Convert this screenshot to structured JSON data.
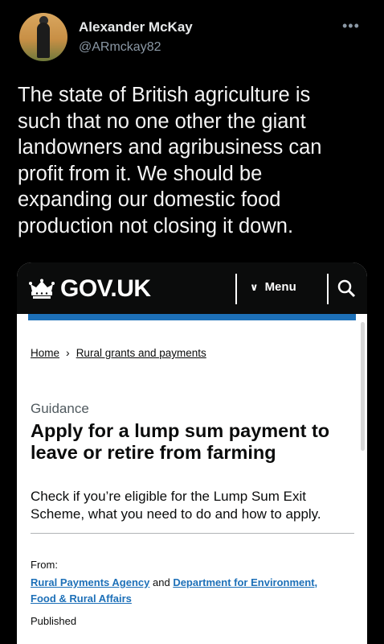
{
  "tweet": {
    "author_name": "Alexander McKay",
    "author_handle": "@ARmckay82",
    "more_icon": "more-horizontal-icon",
    "text_lines": [
      "The state of British agriculture is",
      "such that no one other the giant",
      "landowners and agribusiness can",
      "profit from it. We should be",
      "expanding our domestic food",
      "production not closing it down."
    ]
  },
  "govuk": {
    "logo_text": "GOV.UK",
    "menu_label": "Menu",
    "colors": {
      "header": "#0b0c0c",
      "accent_bar": "#1d70b8",
      "link": "#1d70b8"
    },
    "breadcrumb": {
      "home": "Home",
      "section": "Rural grants and payments"
    },
    "caption": "Guidance",
    "title_lines": [
      "Apply for a lump sum payment to",
      "leave or retire from farming"
    ],
    "lead_lines": [
      "Check if you’re eligible for the Lump Sum Exit",
      "Scheme, what you need to do and how to apply."
    ],
    "from_label": "From:",
    "org1": "Rural Payments Agency",
    "org_and": "and",
    "org2_line1": "Department for Environment,",
    "org2_line2": "Food & Rural Affairs",
    "published_label": "Published"
  }
}
